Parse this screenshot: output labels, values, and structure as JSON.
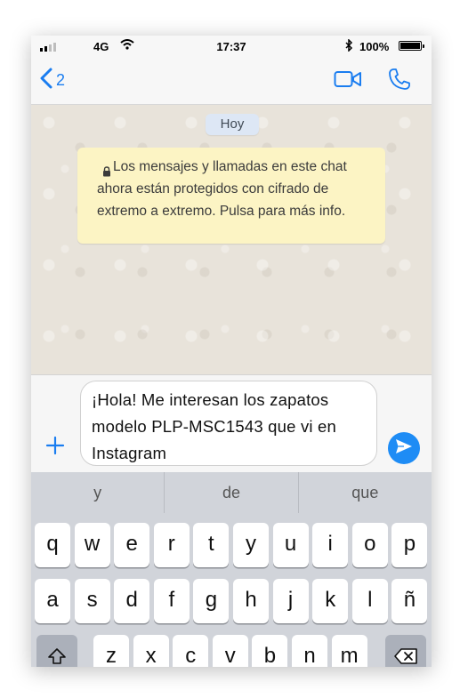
{
  "status_bar": {
    "network": "4G",
    "time": "17:37",
    "battery_percent": "100%",
    "signal_bars": 2,
    "battery_level": 1.0
  },
  "nav": {
    "back_count": "2",
    "accent_color": "#1a7df0"
  },
  "chat": {
    "date_chip": "Hoy",
    "system_note": "Los mensajes y llamadas en este chat ahora están protegidos con cifrado de extremo a extremo. Pulsa para más info."
  },
  "composer": {
    "message_text": "¡Hola! Me interesan los zapatos modelo PLP-MSC1543 que vi en Instagram"
  },
  "keyboard": {
    "suggestions": [
      "y",
      "de",
      "que"
    ],
    "row1": [
      "q",
      "w",
      "e",
      "r",
      "t",
      "y",
      "u",
      "i",
      "o",
      "p"
    ],
    "row2": [
      "a",
      "s",
      "d",
      "f",
      "g",
      "h",
      "j",
      "k",
      "l",
      "ñ"
    ],
    "row3": [
      "z",
      "x",
      "c",
      "v",
      "b",
      "n",
      "m"
    ]
  },
  "icons": {
    "back": "chevron-left-icon",
    "video": "video-camera-icon",
    "call": "phone-icon",
    "lock": "lock-icon",
    "add": "plus-icon",
    "send": "send-arrow-icon",
    "shift": "shift-icon",
    "delete": "backspace-icon"
  }
}
